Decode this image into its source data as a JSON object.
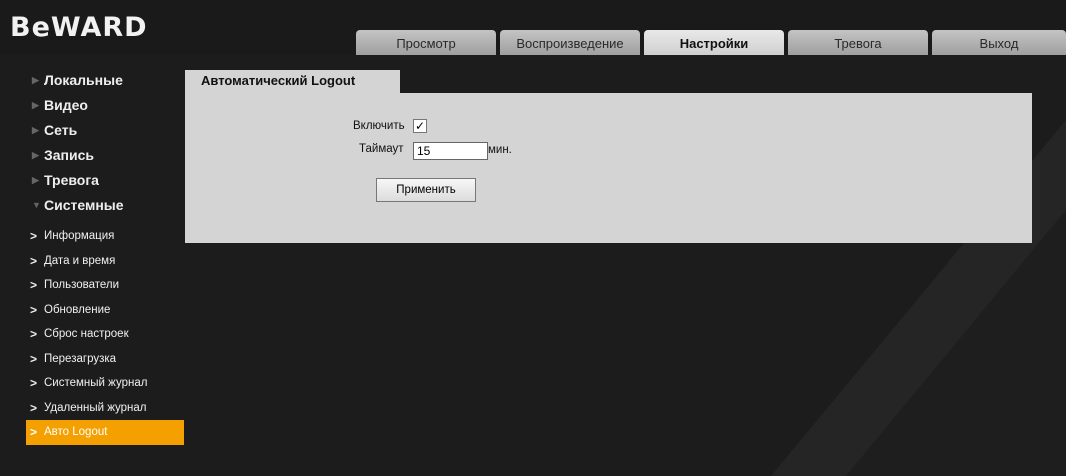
{
  "brand": {
    "logo_text": "BeWARD"
  },
  "tabs": [
    {
      "label": "Просмотр"
    },
    {
      "label": "Воспроизведение"
    },
    {
      "label": "Настройки"
    },
    {
      "label": "Тревога"
    },
    {
      "label": "Выход"
    }
  ],
  "active_tab": "Настройки",
  "sidebar": {
    "sections": [
      {
        "label": "Локальные"
      },
      {
        "label": "Видео"
      },
      {
        "label": "Сеть"
      },
      {
        "label": "Запись"
      },
      {
        "label": "Тревога"
      },
      {
        "label": "Системные"
      }
    ],
    "sub_items": [
      {
        "label": "Информация"
      },
      {
        "label": "Дата и время"
      },
      {
        "label": "Пользователи"
      },
      {
        "label": "Обновление"
      },
      {
        "label": "Сброс настроек"
      },
      {
        "label": "Перезагрузка"
      },
      {
        "label": "Системный журнал"
      },
      {
        "label": "Удаленный журнал"
      },
      {
        "label": "Авто Logout"
      }
    ],
    "active_sub_item": "Авто Logout"
  },
  "panel": {
    "title": "Автоматический Logout",
    "enable_label": "Включить",
    "enable_checked": true,
    "timeout_label": "Таймаут",
    "timeout_value": "15",
    "timeout_unit": "мин.",
    "apply_label": "Применить"
  },
  "colors": {
    "accent": "#f3a000",
    "panel_bg": "#d4d4d4",
    "page_bg": "#1c1c1c"
  }
}
